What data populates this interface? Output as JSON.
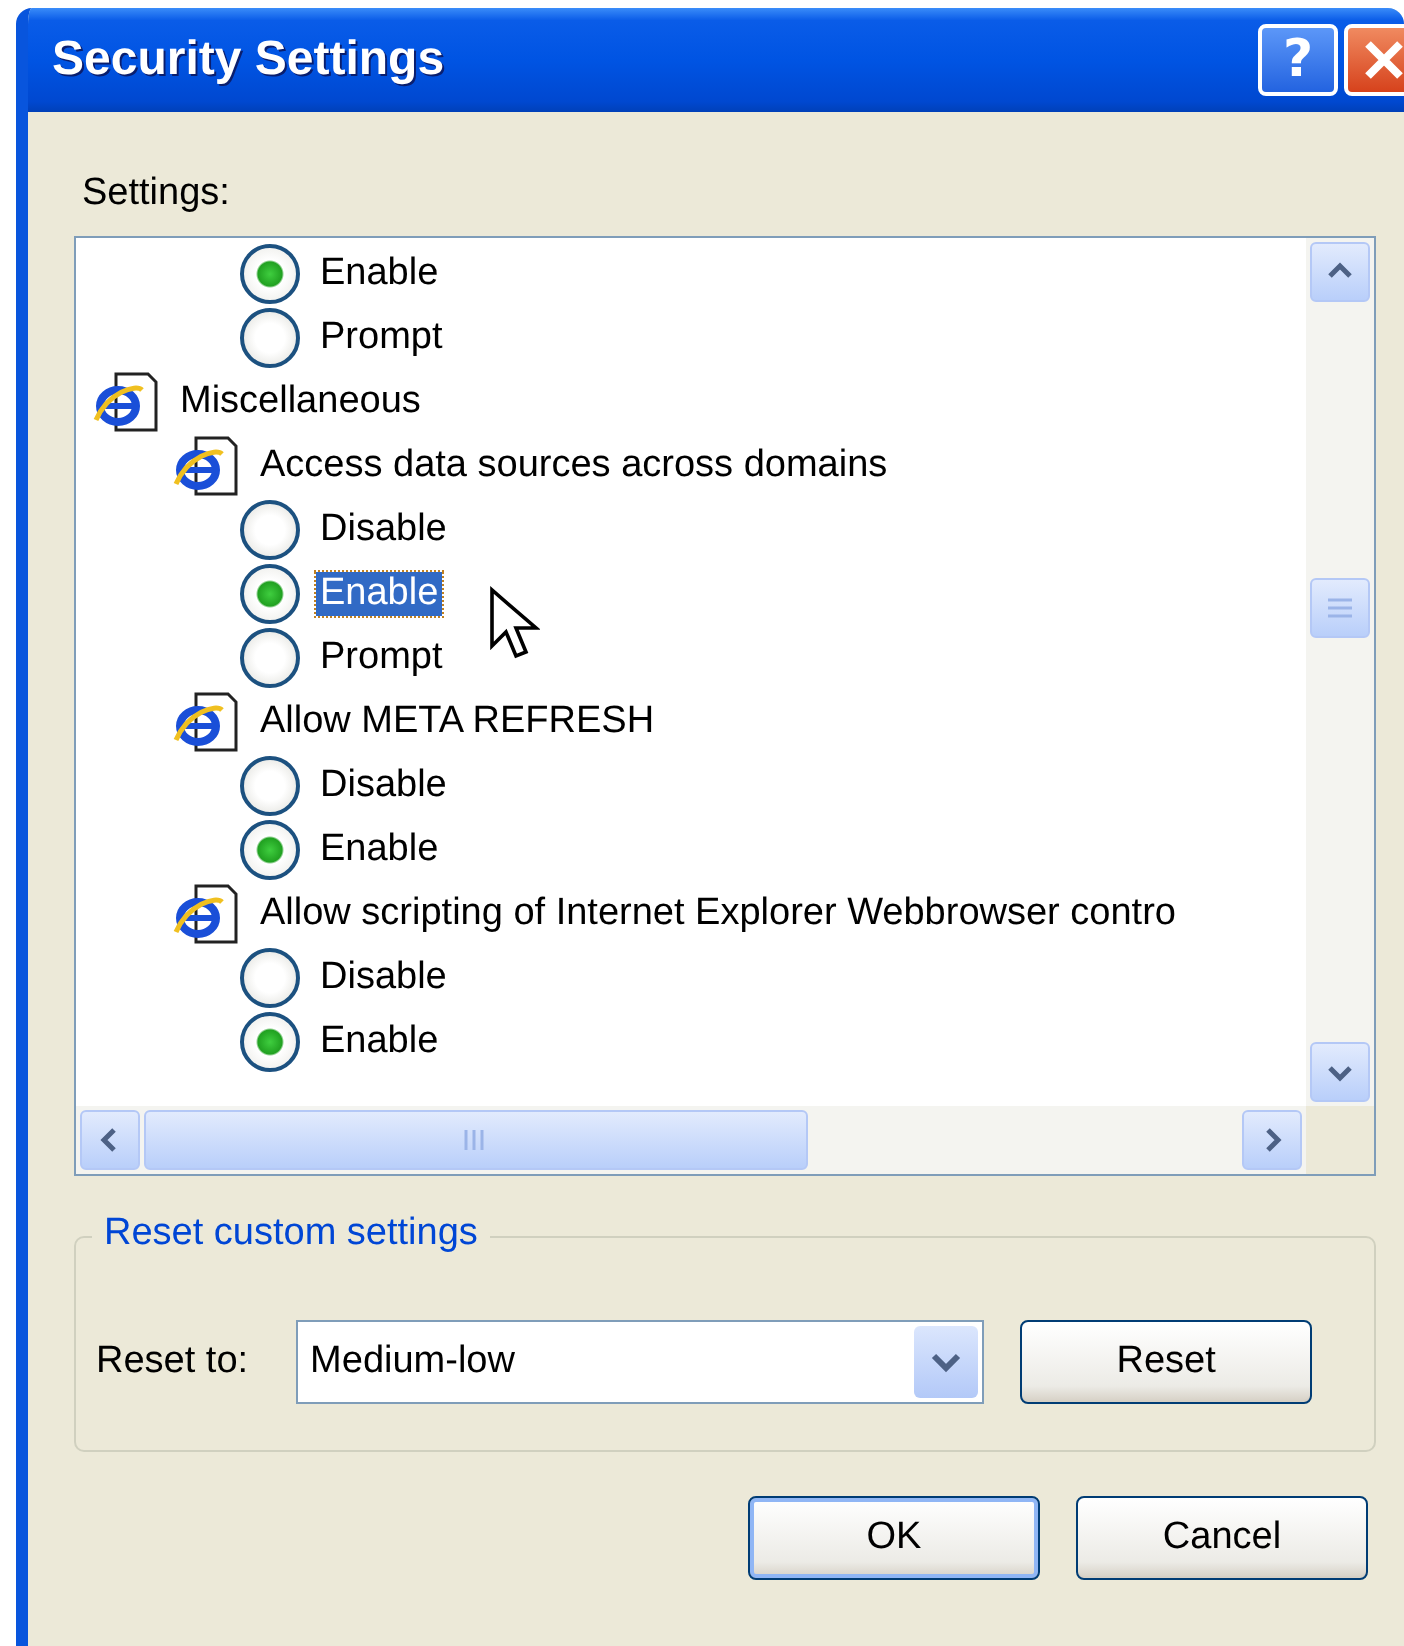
{
  "window": {
    "title": "Security Settings",
    "help_button": "?"
  },
  "settings_label": "Settings:",
  "tree": [
    {
      "kind": "category",
      "children": [
        {
          "kind": "setting",
          "children": [
            {
              "kind": "option",
              "label": "Enable",
              "selected": true,
              "focused": false
            },
            {
              "kind": "option",
              "label": "Prompt",
              "selected": false,
              "focused": false
            }
          ]
        }
      ]
    },
    {
      "kind": "category",
      "label": "Miscellaneous",
      "children": [
        {
          "kind": "setting",
          "label": "Access data sources across domains",
          "children": [
            {
              "kind": "option",
              "label": "Disable",
              "selected": false,
              "focused": false
            },
            {
              "kind": "option",
              "label": "Enable",
              "selected": true,
              "focused": true
            },
            {
              "kind": "option",
              "label": "Prompt",
              "selected": false,
              "focused": false
            }
          ]
        },
        {
          "kind": "setting",
          "label": "Allow META REFRESH",
          "children": [
            {
              "kind": "option",
              "label": "Disable",
              "selected": false,
              "focused": false
            },
            {
              "kind": "option",
              "label": "Enable",
              "selected": true,
              "focused": false
            }
          ]
        },
        {
          "kind": "setting",
          "label": "Allow scripting of Internet Explorer Webbrowser contro",
          "children": [
            {
              "kind": "option",
              "label": "Disable",
              "selected": false,
              "focused": false
            },
            {
              "kind": "option",
              "label": "Enable",
              "selected": true,
              "focused": false
            }
          ]
        }
      ]
    }
  ],
  "reset_group": {
    "legend": "Reset custom settings",
    "label": "Reset to:",
    "value": "Medium-low",
    "button": "Reset"
  },
  "buttons": [
    {
      "label": "OK",
      "default": true
    },
    {
      "label": "Cancel",
      "default": false
    }
  ]
}
